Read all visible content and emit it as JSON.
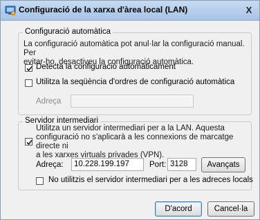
{
  "window": {
    "title": "Configuració de la xarxa d'àrea local (LAN)",
    "close_label": "X"
  },
  "auto_config": {
    "legend": "Configuració automàtica",
    "description_line1": "La configuració automàtica pot anul·lar la configuració manual. Per",
    "description_line2": "evitar-ho, desactiveu la configuració automàtica.",
    "detect_label": "Detecta la configuració automàticament",
    "detect_checked": true,
    "script_label": "Utilitza la seqüència d'ordres de configuració automàtica",
    "script_checked": false,
    "address_label": "Adreça",
    "address_value": ""
  },
  "proxy": {
    "legend": "Servidor intermediari",
    "use_proxy_line1": "Utilitza un servidor intermediari per a la LAN. Aquesta",
    "use_proxy_line2": "configuració no s'aplicarà a les connexions de marcatge directe ni",
    "use_proxy_line3": "a les xarxes virtuals privades (VPN).",
    "use_proxy_checked": true,
    "address_label": "Adreça:",
    "address_value": "10.228.199.197",
    "port_label": "Port:",
    "port_value": "3128",
    "advanced_label": "Avançats",
    "bypass_label": "No utilitzis el servidor intermediari per a les adreces locals",
    "bypass_checked": false
  },
  "footer": {
    "ok_label": "D'acord",
    "cancel_label": "Cancel·la"
  }
}
